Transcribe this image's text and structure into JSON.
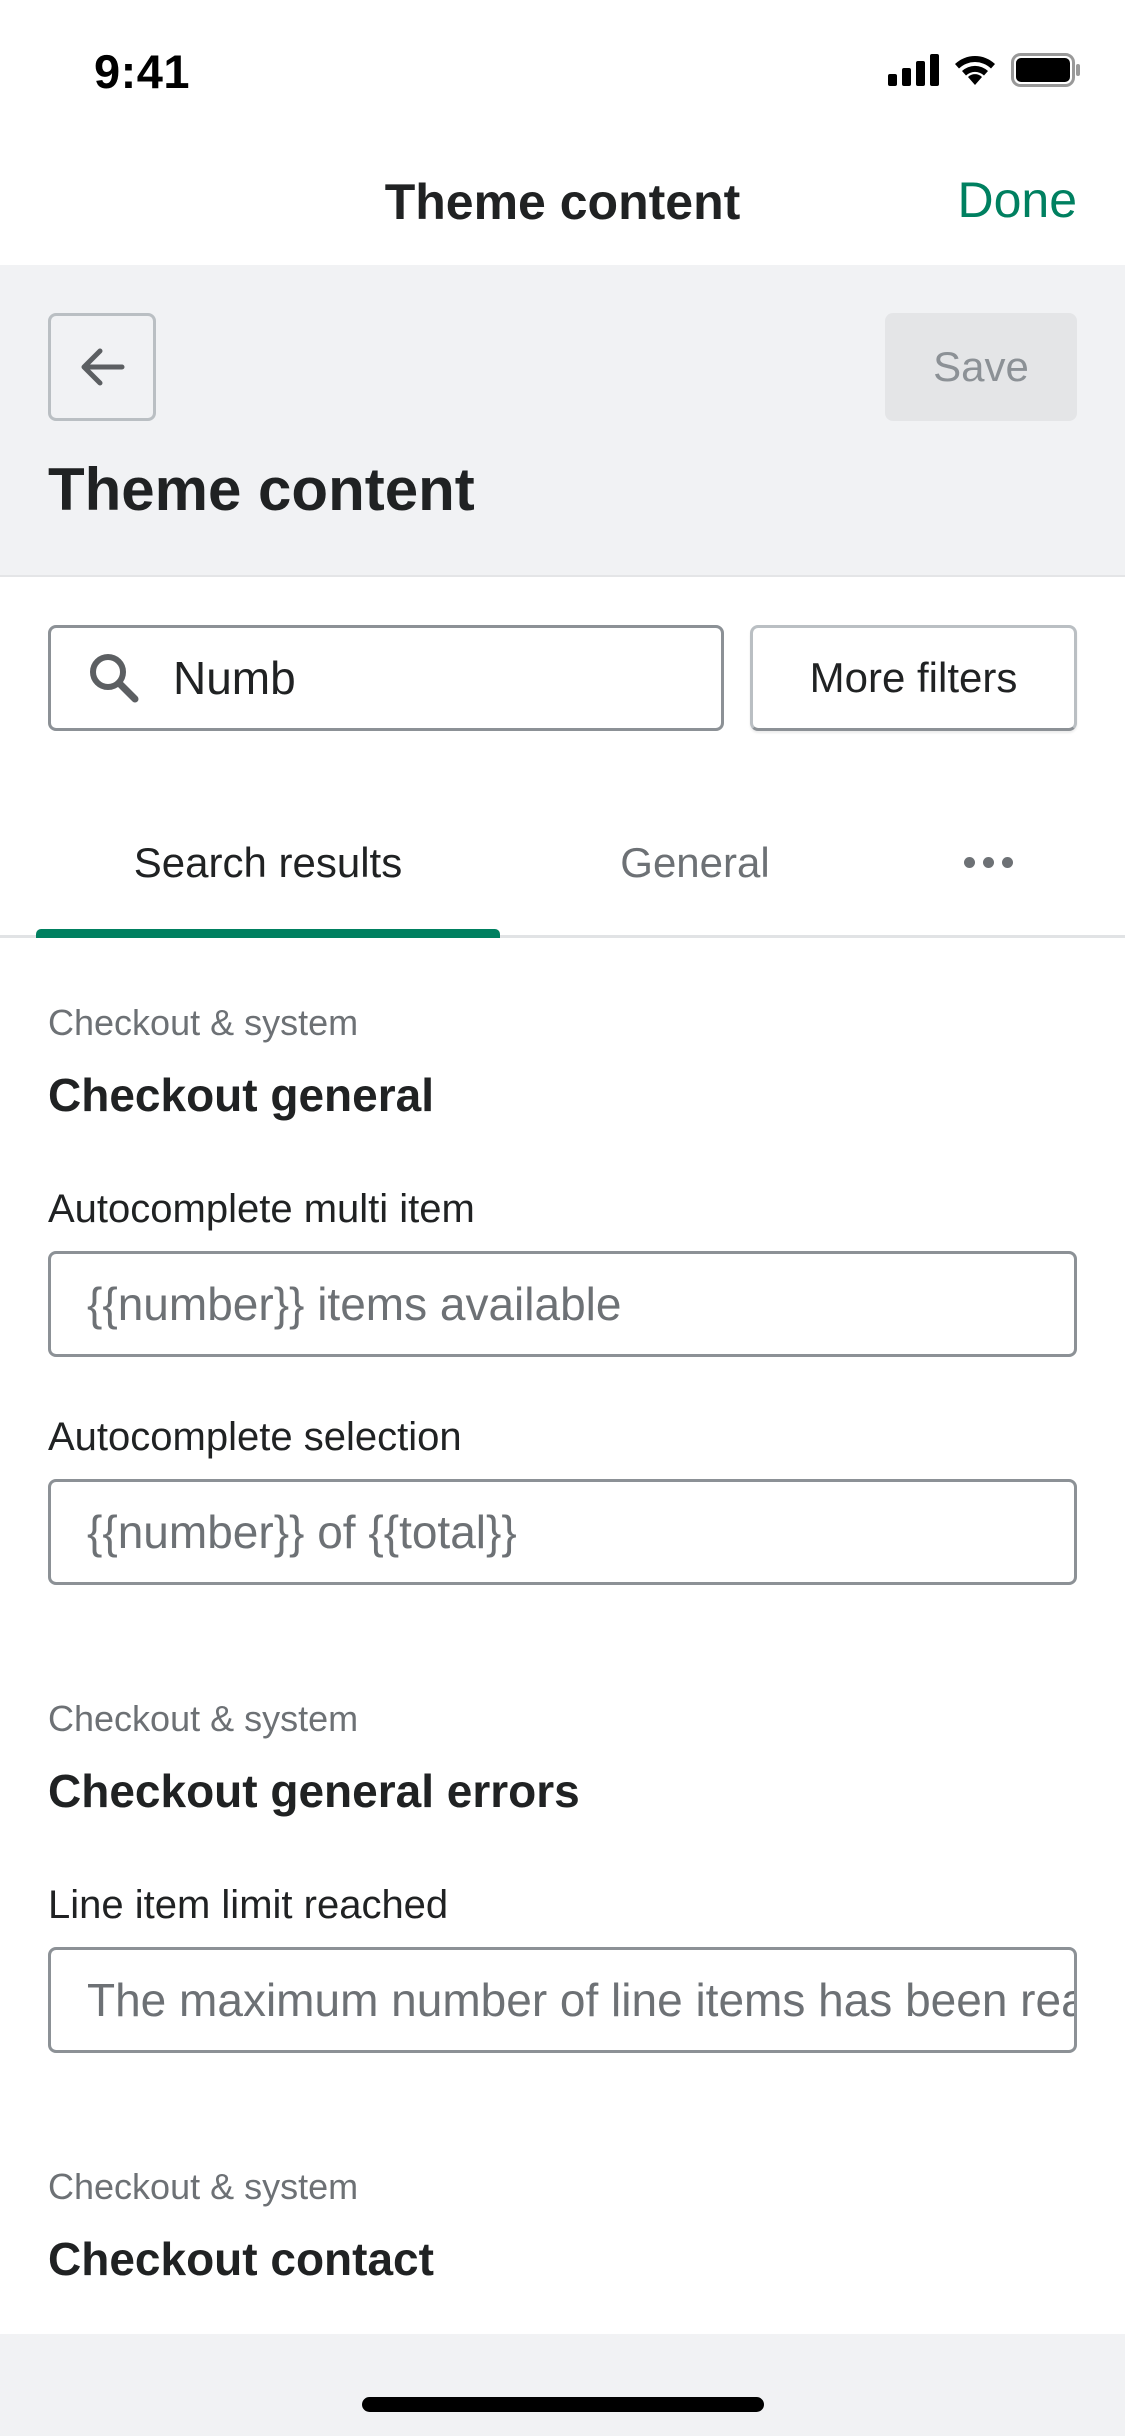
{
  "status_bar": {
    "time": "9:41"
  },
  "nav": {
    "title": "Theme content",
    "done_label": "Done"
  },
  "page_header": {
    "title": "Theme content",
    "save_label": "Save"
  },
  "search": {
    "value": "Numb",
    "filters_label": "More filters"
  },
  "tabs": [
    {
      "label": "Search results",
      "selected": true
    },
    {
      "label": "General",
      "selected": false
    }
  ],
  "sections": [
    {
      "eyebrow": "Checkout & system",
      "heading": "Checkout general",
      "fields": [
        {
          "label": "Autocomplete multi item",
          "placeholder": "{{number}} items available"
        },
        {
          "label": "Autocomplete selection",
          "placeholder": "{{number}} of {{total}}"
        }
      ]
    },
    {
      "eyebrow": "Checkout & system",
      "heading": "Checkout general errors",
      "fields": [
        {
          "label": "Line item limit reached",
          "placeholder": "The maximum number of line items has been reached"
        }
      ]
    },
    {
      "eyebrow": "Checkout & system",
      "heading": "Checkout contact",
      "fields": []
    }
  ],
  "colors": {
    "accent": "#008060",
    "header_bg": "#f1f2f4",
    "border": "#8c9196",
    "subdued_text": "#6d7175"
  },
  "icons": {
    "back": "arrow-left-icon",
    "search": "search-icon",
    "more": "more-horizontal-icon"
  }
}
